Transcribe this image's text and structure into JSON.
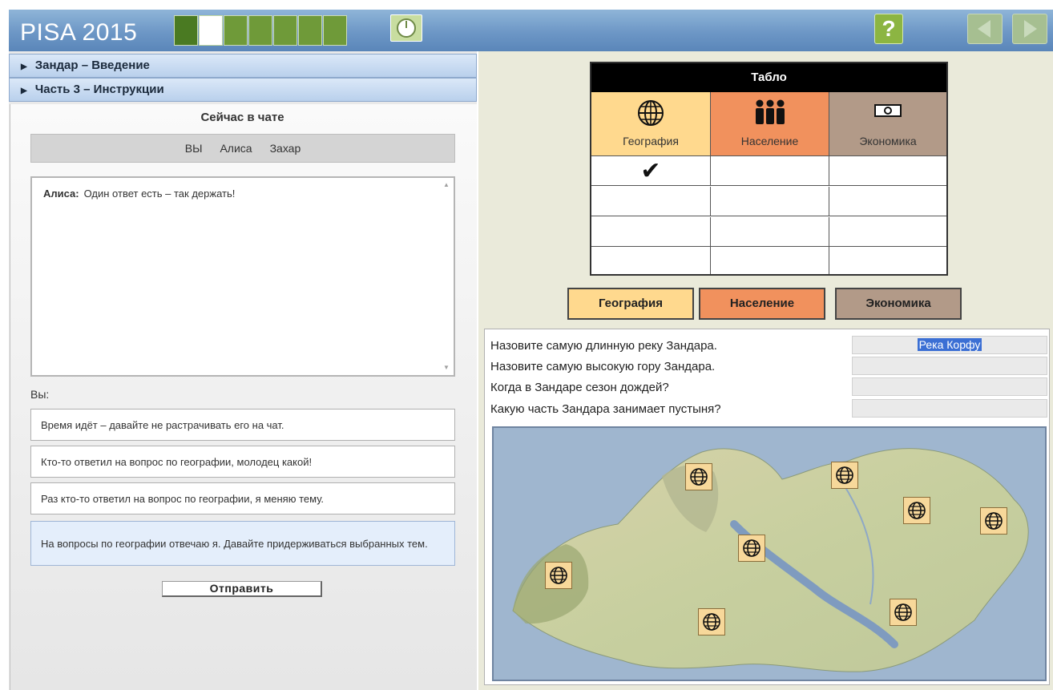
{
  "header": {
    "app_title": "PISA 2015",
    "progress_segments": 8,
    "progress_current_index": 1,
    "help_label": "?",
    "colors": {
      "bar": "#6d97c6",
      "progress": "#6f9a39",
      "help": "#8cb542"
    }
  },
  "sections": [
    {
      "label": "Зандар – Введение"
    },
    {
      "label": "Часть 3 – Инструкции"
    }
  ],
  "chat": {
    "title": "Сейчас в чате",
    "participants": [
      "ВЫ",
      "Алиса",
      "Захар"
    ],
    "messages": [
      {
        "sender": "Алиса:",
        "text": "Один ответ есть – так держать!"
      }
    ],
    "you_label": "Вы:",
    "options": [
      "Время идёт – давайте не растрачивать его на чат.",
      "Кто-то ответил на вопрос по географии, молодец какой!",
      "Раз кто-то ответил на вопрос по географии, я меняю тему.",
      "На вопросы по географии отвечаю я. Давайте придерживаться выбранных тем."
    ],
    "selected_option": 3,
    "send_label": "Отправить"
  },
  "scoreboard": {
    "title": "Табло",
    "columns": [
      {
        "label": "География",
        "icon": "globe-icon",
        "color": "#ffd98e"
      },
      {
        "label": "Население",
        "icon": "people-icon",
        "color": "#f1915d"
      },
      {
        "label": "Экономика",
        "icon": "money-icon",
        "color": "#b29a88"
      }
    ],
    "cells": [
      [
        "✔",
        "",
        ""
      ],
      [
        "",
        "",
        ""
      ],
      [
        "",
        "",
        ""
      ],
      [
        "",
        "",
        ""
      ]
    ]
  },
  "topic_buttons": [
    "География",
    "Население",
    "Экономика"
  ],
  "questions": [
    {
      "text": "Назовите самую длинную реку Зандара.",
      "answer": "Река Корфу"
    },
    {
      "text": "Назовите самую высокую гору Зандара.",
      "answer": ""
    },
    {
      "text": "Когда в Зандаре сезон дождей?",
      "answer": ""
    },
    {
      "text": "Какую часть Зандара занимает пустыня?",
      "answer": ""
    }
  ],
  "map": {
    "marker_icon": "globe-icon",
    "marker_count": 8
  }
}
